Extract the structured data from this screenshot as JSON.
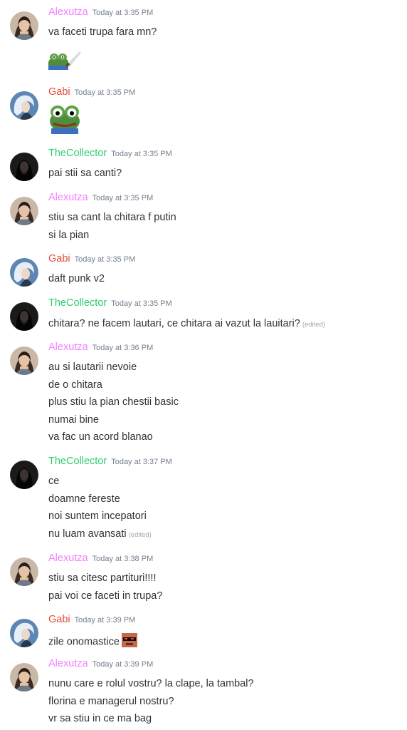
{
  "colors": {
    "alexutza": "#f47fff",
    "gabi": "#e74c3c",
    "collector": "#2ecc71",
    "timestamp": "#747f8d",
    "text": "#2e3338"
  },
  "messages": [
    {
      "author": "Alexutza",
      "time": "Today at 3:35 PM",
      "lines": [
        "va faceti trupa fara mn?"
      ],
      "emoji": "pepe-knife-icon"
    },
    {
      "author": "Gabi",
      "time": "Today at 3:35 PM",
      "lines": [],
      "emoji": "pepe-frog-icon"
    },
    {
      "author": "TheCollector",
      "time": "Today at 3:35 PM",
      "lines": [
        "pai stii sa canti?"
      ]
    },
    {
      "author": "Alexutza",
      "time": "Today at 3:35 PM",
      "lines": [
        "stiu sa cant la chitara f putin",
        "si la pian"
      ]
    },
    {
      "author": "Gabi",
      "time": "Today at 3:35 PM",
      "lines": [
        "daft punk v2"
      ]
    },
    {
      "author": "TheCollector",
      "time": "Today at 3:35 PM",
      "lines": [
        "chitara? ne facem lautari, ce chitara ai vazut la lauitari?"
      ],
      "edited": "(edited)"
    },
    {
      "author": "Alexutza",
      "time": "Today at 3:36 PM",
      "lines": [
        "au si lautarii nevoie",
        "de o chitara",
        "plus stiu la pian chestii basic",
        "numai bine",
        "va fac un acord blanao"
      ]
    },
    {
      "author": "TheCollector",
      "time": "Today at 3:37 PM",
      "lines": [
        "ce",
        "doamne fereste",
        "noi suntem incepatori",
        "nu luam avansati"
      ],
      "edited": "(edited)"
    },
    {
      "author": "Alexutza",
      "time": "Today at 3:38 PM",
      "lines": [
        "stiu sa citesc partituri!!!!",
        "pai voi ce faceti in trupa?"
      ]
    },
    {
      "author": "Gabi",
      "time": "Today at 3:39 PM",
      "lines": [
        "zile onomastice"
      ],
      "inline_emoji": "deal-with-it-icon"
    },
    {
      "author": "Alexutza",
      "time": "Today at 3:39 PM",
      "lines": [
        "nunu care e rolul vostru? la clape, la tambal?",
        "florina e managerul nostru?",
        "vr sa stiu in ce ma bag"
      ]
    }
  ]
}
